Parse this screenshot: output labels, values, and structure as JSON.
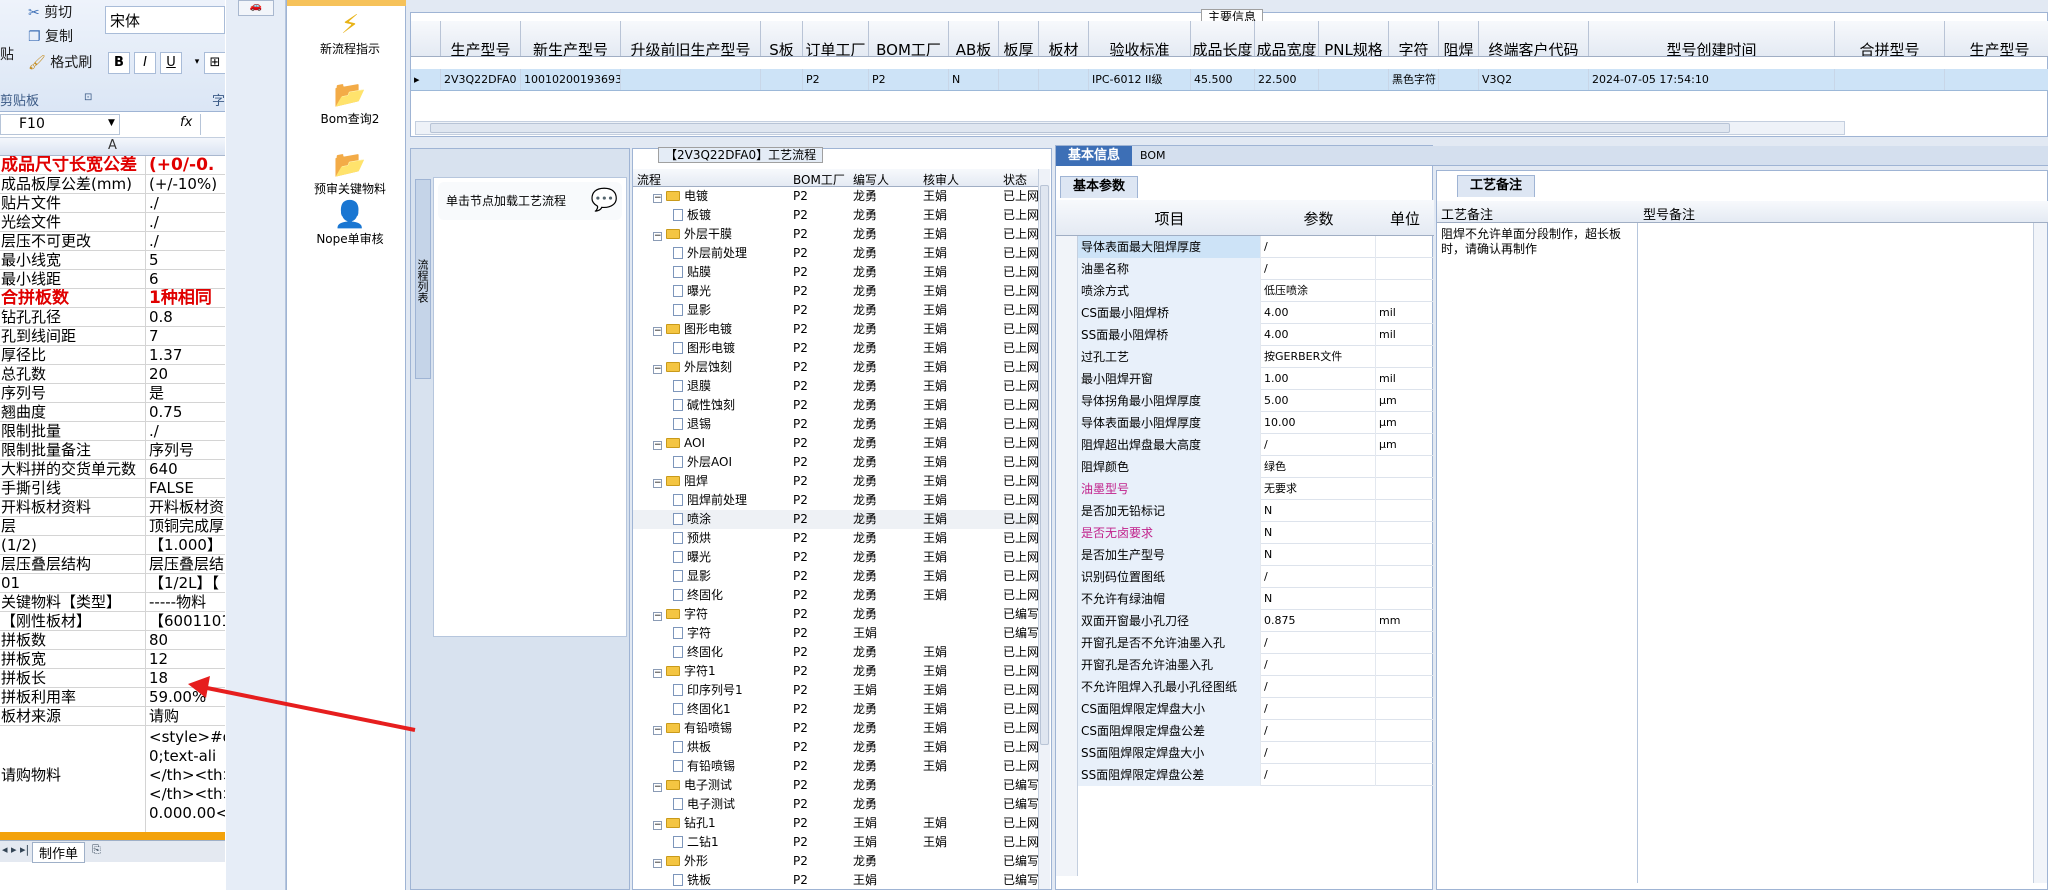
{
  "excel": {
    "clipboard": {
      "cut": "剪切",
      "copy": "复制",
      "format_painter": "格式刷",
      "paste": "贴",
      "group": "剪贴板"
    },
    "font": {
      "name": "宋体",
      "bold": "B",
      "italic": "I",
      "underline": "U",
      "group": "字"
    },
    "name_box": "F10",
    "fx": "fx",
    "col_a": "A",
    "rows": [
      {
        "a": "成品尺寸长宽公差",
        "b": "(+0/-0.",
        "red": true
      },
      {
        "a": "成品板厚公差(mm)",
        "b": "(+/-10%)"
      },
      {
        "a": "贴片文件",
        "b": "./"
      },
      {
        "a": "光绘文件",
        "b": "./"
      },
      {
        "a": "层压不可更改",
        "b": "./"
      },
      {
        "a": "最小线宽",
        "b": "5"
      },
      {
        "a": "最小线距",
        "b": "6"
      },
      {
        "a": "合拼板数",
        "b": "1种相同",
        "red": true
      },
      {
        "a": "钻孔孔径",
        "b": "0.8"
      },
      {
        "a": "孔到线间距",
        "b": "7"
      },
      {
        "a": "厚径比",
        "b": "1.37"
      },
      {
        "a": "总孔数",
        "b": "20"
      },
      {
        "a": "序列号",
        "b": "是"
      },
      {
        "a": "翘曲度",
        "b": "0.75"
      },
      {
        "a": "限制批量",
        "b": "./"
      },
      {
        "a": "限制批量备注",
        "b": "序列号"
      },
      {
        "a": "大料拼的交货单元数",
        "b": "640"
      },
      {
        "a": "手撕引线",
        "b": "FALSE"
      },
      {
        "a": "开料板材资料",
        "b": "开料板材资"
      },
      {
        "a": "层",
        "b": "顶铜完成厚"
      },
      {
        "a": "(1/2)",
        "b": "【1.000】"
      },
      {
        "a": "层压叠层结构",
        "b": "层压叠层结"
      },
      {
        "a": "01",
        "b": "【1/2L】【"
      },
      {
        "a": "关键物料【类型】",
        "b": "-----物料"
      },
      {
        "a": "【刚性板材】",
        "b": "【6001101"
      },
      {
        "a": "拼板数",
        "b": "80"
      },
      {
        "a": "拼板宽",
        "b": "12"
      },
      {
        "a": "拼板长",
        "b": "18"
      },
      {
        "a": "拼板利用率",
        "b": "59.00%"
      },
      {
        "a": "板材来源",
        "b": "请购"
      }
    ],
    "tall_row": {
      "a": "请购物料",
      "b": "<style>#q:\n0;text-ali\n</th><th>\n</th><th>#\n0.000.00<"
    },
    "sheet_tab": "制作单"
  },
  "sidebar": {
    "tools": [
      {
        "label": "新流程指示",
        "icon": "lightning-icon"
      },
      {
        "label": "Bom查询2",
        "icon": "folder-icon"
      },
      {
        "label": "预审关键物料",
        "icon": "folder-icon"
      },
      {
        "label": "Nope单审核",
        "icon": "user-icon"
      }
    ]
  },
  "top_table": {
    "title": "主要信息",
    "headers": [
      "生产型号",
      "新生产型号",
      "升级前旧生产型号",
      "S板",
      "订单工厂",
      "BOM工厂",
      "AB板",
      "板厚",
      "板材",
      "验收标准",
      "成品长度",
      "成品宽度",
      "PNL规格",
      "字符",
      "阻焊",
      "终端客户代码",
      "型号创建时间",
      "合拼型号",
      "生产型号"
    ],
    "row": [
      "2V3Q22DFA0",
      "10010200193693",
      "",
      "",
      "P2",
      "P2",
      "N",
      "",
      "",
      "IPC-6012 II级",
      "45.500",
      "22.500",
      "",
      "黑色字符",
      "",
      "V3Q2",
      "2024-07-05 17:54:10",
      "",
      ""
    ]
  },
  "left_panel": {
    "vertical_tab": "流程列表",
    "item": "单击节点加载工艺流程"
  },
  "process": {
    "title": "【2V3Q22DFA0】工艺流程",
    "headers": [
      "流程",
      "BOM工厂",
      "编写人",
      "核审人",
      "状态"
    ],
    "rows": [
      {
        "level": 0,
        "name": "电镀",
        "bom": "P2",
        "writer": "龙勇",
        "reviewer": "王娟",
        "status": "已上网"
      },
      {
        "level": 1,
        "name": "板镀",
        "bom": "P2",
        "writer": "龙勇",
        "reviewer": "王娟",
        "status": "已上网"
      },
      {
        "level": 0,
        "name": "外层干膜",
        "bom": "P2",
        "writer": "龙勇",
        "reviewer": "王娟",
        "status": "已上网"
      },
      {
        "level": 1,
        "name": "外层前处理",
        "bom": "P2",
        "writer": "龙勇",
        "reviewer": "王娟",
        "status": "已上网"
      },
      {
        "level": 1,
        "name": "贴膜",
        "bom": "P2",
        "writer": "龙勇",
        "reviewer": "王娟",
        "status": "已上网"
      },
      {
        "level": 1,
        "name": "曝光",
        "bom": "P2",
        "writer": "龙勇",
        "reviewer": "王娟",
        "status": "已上网"
      },
      {
        "level": 1,
        "name": "显影",
        "bom": "P2",
        "writer": "龙勇",
        "reviewer": "王娟",
        "status": "已上网"
      },
      {
        "level": 0,
        "name": "图形电镀",
        "bom": "P2",
        "writer": "龙勇",
        "reviewer": "王娟",
        "status": "已上网"
      },
      {
        "level": 1,
        "name": "图形电镀",
        "bom": "P2",
        "writer": "龙勇",
        "reviewer": "王娟",
        "status": "已上网"
      },
      {
        "level": 0,
        "name": "外层蚀刻",
        "bom": "P2",
        "writer": "龙勇",
        "reviewer": "王娟",
        "status": "已上网"
      },
      {
        "level": 1,
        "name": "退膜",
        "bom": "P2",
        "writer": "龙勇",
        "reviewer": "王娟",
        "status": "已上网"
      },
      {
        "level": 1,
        "name": "碱性蚀刻",
        "bom": "P2",
        "writer": "龙勇",
        "reviewer": "王娟",
        "status": "已上网"
      },
      {
        "level": 1,
        "name": "退锡",
        "bom": "P2",
        "writer": "龙勇",
        "reviewer": "王娟",
        "status": "已上网"
      },
      {
        "level": 0,
        "name": "AOI",
        "bom": "P2",
        "writer": "龙勇",
        "reviewer": "王娟",
        "status": "已上网"
      },
      {
        "level": 1,
        "name": "外层AOI",
        "bom": "P2",
        "writer": "龙勇",
        "reviewer": "王娟",
        "status": "已上网"
      },
      {
        "level": 0,
        "name": "阻焊",
        "bom": "P2",
        "writer": "龙勇",
        "reviewer": "王娟",
        "status": "已上网"
      },
      {
        "level": 1,
        "name": "阻焊前处理",
        "bom": "P2",
        "writer": "龙勇",
        "reviewer": "王娟",
        "status": "已上网"
      },
      {
        "level": 1,
        "name": "喷涂",
        "bom": "P2",
        "writer": "龙勇",
        "reviewer": "王娟",
        "status": "已上网",
        "selected": true
      },
      {
        "level": 1,
        "name": "预烘",
        "bom": "P2",
        "writer": "龙勇",
        "reviewer": "王娟",
        "status": "已上网"
      },
      {
        "level": 1,
        "name": "曝光",
        "bom": "P2",
        "writer": "龙勇",
        "reviewer": "王娟",
        "status": "已上网"
      },
      {
        "level": 1,
        "name": "显影",
        "bom": "P2",
        "writer": "龙勇",
        "reviewer": "王娟",
        "status": "已上网"
      },
      {
        "level": 1,
        "name": "终固化",
        "bom": "P2",
        "writer": "龙勇",
        "reviewer": "王娟",
        "status": "已上网"
      },
      {
        "level": 0,
        "name": "字符",
        "bom": "P2",
        "writer": "龙勇",
        "reviewer": "",
        "status": "已编写"
      },
      {
        "level": 1,
        "name": "字符",
        "bom": "P2",
        "writer": "王娟",
        "reviewer": "",
        "status": "已编写"
      },
      {
        "level": 1,
        "name": "终固化",
        "bom": "P2",
        "writer": "龙勇",
        "reviewer": "王娟",
        "status": "已上网"
      },
      {
        "level": 0,
        "name": "字符1",
        "bom": "P2",
        "writer": "龙勇",
        "reviewer": "王娟",
        "status": "已上网"
      },
      {
        "level": 1,
        "name": "印序列号1",
        "bom": "P2",
        "writer": "王娟",
        "reviewer": "王娟",
        "status": "已上网"
      },
      {
        "level": 1,
        "name": "终固化1",
        "bom": "P2",
        "writer": "龙勇",
        "reviewer": "王娟",
        "status": "已上网"
      },
      {
        "level": 0,
        "name": "有铅喷锡",
        "bom": "P2",
        "writer": "龙勇",
        "reviewer": "王娟",
        "status": "已上网"
      },
      {
        "level": 1,
        "name": "烘板",
        "bom": "P2",
        "writer": "龙勇",
        "reviewer": "王娟",
        "status": "已上网"
      },
      {
        "level": 1,
        "name": "有铅喷锡",
        "bom": "P2",
        "writer": "龙勇",
        "reviewer": "王娟",
        "status": "已上网"
      },
      {
        "level": 0,
        "name": "电子测试",
        "bom": "P2",
        "writer": "龙勇",
        "reviewer": "",
        "status": "已编写"
      },
      {
        "level": 1,
        "name": "电子测试",
        "bom": "P2",
        "writer": "龙勇",
        "reviewer": "",
        "status": "已编写"
      },
      {
        "level": 0,
        "name": "钻孔1",
        "bom": "P2",
        "writer": "王娟",
        "reviewer": "王娟",
        "status": "已上网"
      },
      {
        "level": 1,
        "name": "二钻1",
        "bom": "P2",
        "writer": "王娟",
        "reviewer": "王娟",
        "status": "已上网"
      },
      {
        "level": 0,
        "name": "外形",
        "bom": "P2",
        "writer": "龙勇",
        "reviewer": "",
        "status": "已编写"
      },
      {
        "level": 1,
        "name": "铣板",
        "bom": "P2",
        "writer": "王娟",
        "reviewer": "",
        "status": "已编写"
      }
    ]
  },
  "basic": {
    "tabs": [
      "基本信息",
      "BOM"
    ],
    "subtab": "基本参数",
    "headers": [
      "项目",
      "参数",
      "单位"
    ],
    "rows": [
      {
        "item": "导体表面最大阻焊厚度",
        "value": "/",
        "unit": "",
        "selected": true
      },
      {
        "item": "油墨名称",
        "value": "/",
        "unit": ""
      },
      {
        "item": "喷涂方式",
        "value": "低压喷涂",
        "unit": ""
      },
      {
        "item": "CS面最小阻焊桥",
        "value": "4.00",
        "unit": "mil"
      },
      {
        "item": "SS面最小阻焊桥",
        "value": "4.00",
        "unit": "mil"
      },
      {
        "item": "过孔工艺",
        "value": "按GERBER文件",
        "unit": ""
      },
      {
        "item": "最小阻焊开窗",
        "value": "1.00",
        "unit": "mil"
      },
      {
        "item": "导体拐角最小阻焊厚度",
        "value": "5.00",
        "unit": "μm"
      },
      {
        "item": "导体表面最小阻焊厚度",
        "value": "10.00",
        "unit": "μm"
      },
      {
        "item": "阻焊超出焊盘最大高度",
        "value": "/",
        "unit": "μm"
      },
      {
        "item": "阻焊颜色",
        "value": "绿色",
        "unit": ""
      },
      {
        "item": "油墨型号",
        "value": "无要求",
        "unit": "",
        "pink": true
      },
      {
        "item": "是否加无铅标记",
        "value": "N",
        "unit": ""
      },
      {
        "item": "是否无卤要求",
        "value": "N",
        "unit": "",
        "pink": true
      },
      {
        "item": "是否加生产型号",
        "value": "N",
        "unit": ""
      },
      {
        "item": "识别码位置图纸",
        "value": "/",
        "unit": ""
      },
      {
        "item": "不允许有绿油帽",
        "value": "N",
        "unit": ""
      },
      {
        "item": "双面开窗最小孔刀径",
        "value": "0.875",
        "unit": "mm"
      },
      {
        "item": "开窗孔是否不允许油墨入孔",
        "value": "/",
        "unit": ""
      },
      {
        "item": "开窗孔是否允许油墨入孔",
        "value": "/",
        "unit": ""
      },
      {
        "item": "不允许阻焊入孔最小孔径图纸",
        "value": "/",
        "unit": ""
      },
      {
        "item": "CS面阻焊限定焊盘大小",
        "value": "/",
        "unit": ""
      },
      {
        "item": "CS面阻焊限定焊盘公差",
        "value": "/",
        "unit": ""
      },
      {
        "item": "SS面阻焊限定焊盘大小",
        "value": "/",
        "unit": ""
      },
      {
        "item": "SS面阻焊限定焊盘公差",
        "value": "/",
        "unit": ""
      }
    ]
  },
  "notes": {
    "tab": "工艺备注",
    "col1": "工艺备注",
    "col2": "型号备注",
    "text": "阻焊不允许单面分段制作，超长板时，请确认再制作",
    "model_note": ""
  },
  "colors": {
    "accent": "#3d6fb6",
    "red_arrow": "#e61e1e",
    "selection": "#cde3f7",
    "pink_text": "#c0208a"
  }
}
